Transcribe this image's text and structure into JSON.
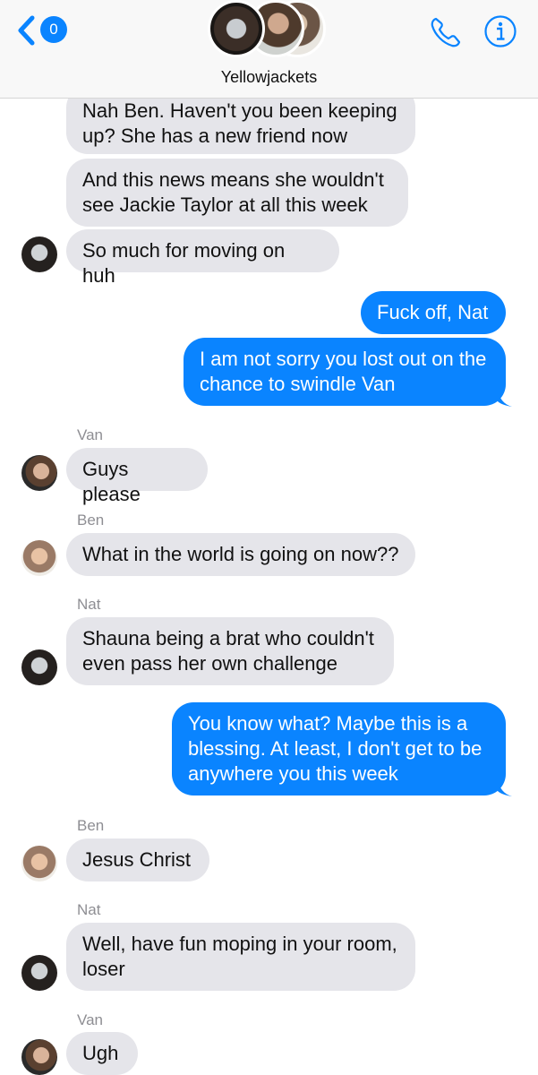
{
  "header": {
    "unread_count": "0",
    "title": "Yellowjackets",
    "back_icon": "chevron-left-icon",
    "phone_icon": "phone-icon",
    "info_icon": "info-icon"
  },
  "colors": {
    "outgoing": "#0a84ff",
    "incoming": "#e5e5ea",
    "header_bg": "#f8f8f8"
  },
  "messages": [
    {
      "dir": "in",
      "text": "Nah Ben. Haven't you been keeping\nup? She has a new friend now"
    },
    {
      "dir": "in",
      "text": "And this news means she wouldn't\nsee Jackie Taylor at all this week"
    },
    {
      "dir": "in",
      "text": "So much for moving on huh"
    },
    {
      "dir": "out",
      "text": "Fuck off, Nat"
    },
    {
      "dir": "out",
      "text": "I am not sorry you lost out on the\nchance to swindle Van"
    },
    {
      "dir": "in",
      "sender": "Van",
      "text": "Guys please"
    },
    {
      "dir": "in",
      "sender": "Ben",
      "text": "What in the world is going on now??"
    },
    {
      "dir": "in",
      "sender": "Nat",
      "text": "Shauna being a brat who couldn't\neven pass her own challenge"
    },
    {
      "dir": "out",
      "text": "You know what? Maybe this is a\nblessing. At least, I don't get to be\nanywhere you this week"
    },
    {
      "dir": "in",
      "sender": "Ben",
      "text": "Jesus Christ"
    },
    {
      "dir": "in",
      "sender": "Nat",
      "text": "Well, have fun moping in your room,\nloser"
    },
    {
      "dir": "in",
      "sender": "Van",
      "text": "Ugh"
    }
  ]
}
